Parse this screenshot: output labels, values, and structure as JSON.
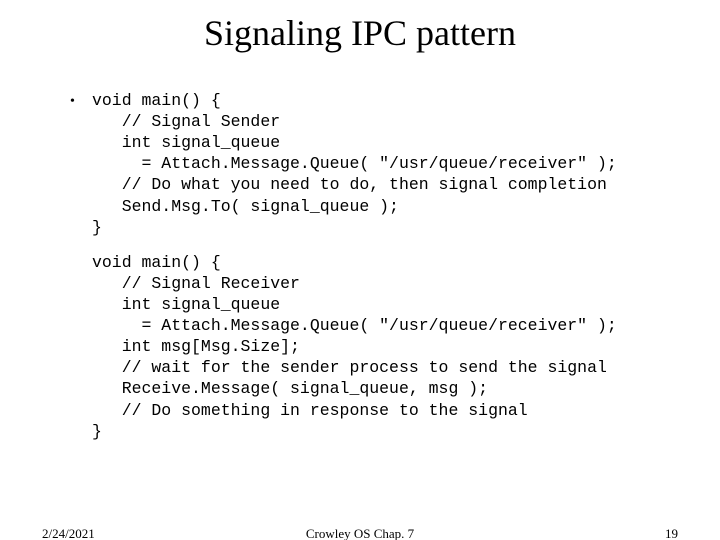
{
  "title": "Signaling IPC pattern",
  "code_block_1": "void main() {\n   // Signal Sender\n   int signal_queue\n     = Attach.Message.Queue( \"/usr/queue/receiver\" );\n   // Do what you need to do, then signal completion\n   Send.Msg.To( signal_queue );\n}",
  "code_block_2": "void main() {\n   // Signal Receiver\n   int signal_queue\n     = Attach.Message.Queue( \"/usr/queue/receiver\" );\n   int msg[Msg.Size];\n   // wait for the sender process to send the signal\n   Receive.Message( signal_queue, msg );\n   // Do something in response to the signal\n}",
  "footer": {
    "date": "2/24/2021",
    "center": "Crowley   OS   Chap. 7",
    "page": "19"
  }
}
